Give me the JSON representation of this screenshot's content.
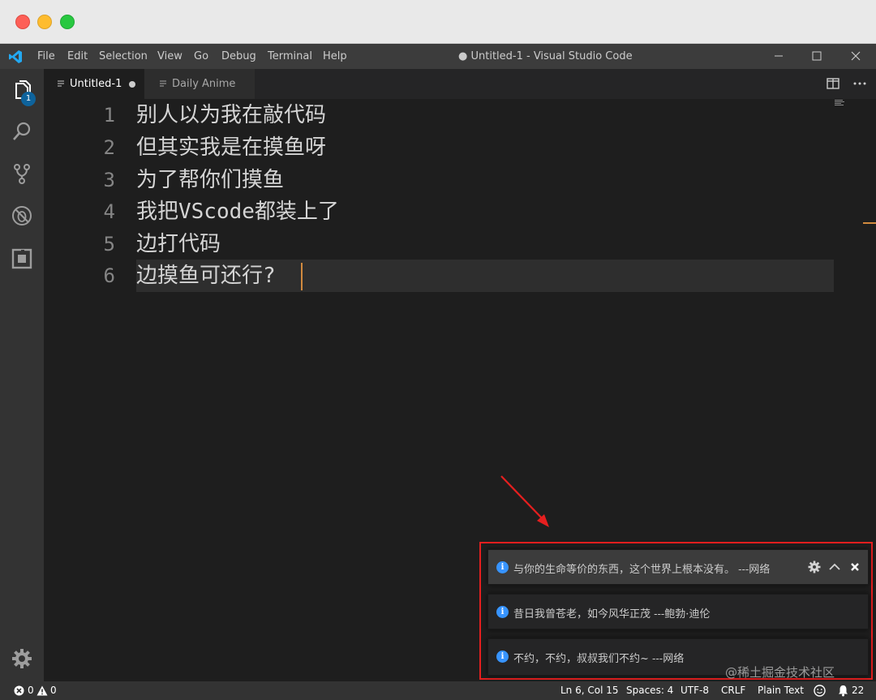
{
  "menubar": {
    "items": [
      "File",
      "Edit",
      "Selection",
      "View",
      "Go",
      "Debug",
      "Terminal",
      "Help"
    ],
    "title": "● Untitled-1 - Visual Studio Code",
    "controls": [
      "minimize-icon",
      "maximize-icon",
      "close-icon"
    ]
  },
  "activity": {
    "icons": [
      "explorer-icon",
      "search-icon",
      "source-control-icon",
      "debug-icon",
      "extensions-icon",
      "settings-gear-icon"
    ],
    "explorer_badge": "1"
  },
  "tabs": [
    {
      "label": "Untitled-1",
      "active": true,
      "dirty": true
    },
    {
      "label": "Daily Anime",
      "active": false,
      "dirty": false
    }
  ],
  "editor": {
    "lines": [
      {
        "no": "1",
        "text": "别人以为我在敲代码"
      },
      {
        "no": "2",
        "text": "但其实我是在摸鱼呀"
      },
      {
        "no": "3",
        "text": "为了帮你们摸鱼"
      },
      {
        "no": "4",
        "text": "我把VScode都装上了"
      },
      {
        "no": "5",
        "text": "边打代码"
      },
      {
        "no": "6",
        "text": "边摸鱼可还行?"
      }
    ],
    "active_line": 6
  },
  "notifications": [
    {
      "text": "与你的生命等价的东西，这个世界上根本没有。 ---网络",
      "icon": "info-icon"
    },
    {
      "text": "昔日我曾苍老，如今风华正茂 ---鲍勃·迪伦",
      "icon": "info-icon"
    },
    {
      "text": "不约，不约，叔叔我们不约~ ---网络",
      "icon": "info-icon"
    }
  ],
  "watermark": "@稀土掘金技术社区",
  "statusbar": {
    "errors": "0",
    "warnings": "0",
    "position": "Ln 6, Col 15",
    "spaces": "Spaces: 4",
    "encoding": "UTF-8",
    "eol": "CRLF",
    "language": "Plain Text",
    "notifications_count": "22"
  },
  "colors": {
    "accent": "#0e639c",
    "cursor": "#d18a3e",
    "annotation": "#e51f1f",
    "info": "#3794ff"
  }
}
